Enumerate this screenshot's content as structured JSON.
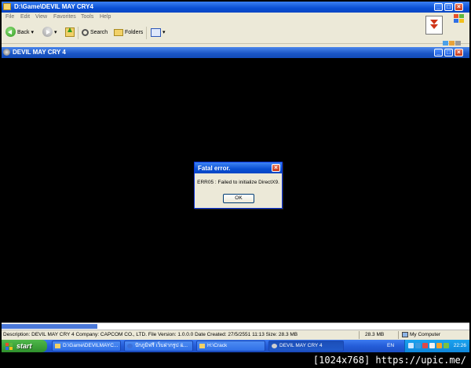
{
  "explorer": {
    "title": "D:\\Game\\DEVIL MAY CRY4",
    "menu": [
      "File",
      "Edit",
      "View",
      "Favorites",
      "Tools",
      "Help"
    ],
    "toolbar": {
      "back_label": "Back",
      "search_label": "Search",
      "folders_label": "Folders"
    },
    "status": {
      "description": "Description: DEVIL MAY CRY 4 Company: CAPCOM CO., LTD. File Version: 1.0.0.0 Date Created: 27/5/2551 11:13 Size: 28.3 MB",
      "size": "28.3 MB",
      "location": "My Computer"
    }
  },
  "game_window": {
    "title": "DEVIL MAY CRY 4"
  },
  "dialog": {
    "title": "Fatal error.",
    "message": "ERR05 : Failed to initialize DirectX9.",
    "ok_label": "OK"
  },
  "taskbar": {
    "start_label": "start",
    "tasks": [
      {
        "label": "D:\\Game\\DEVILMAYC..."
      },
      {
        "label": "ปักภูมิฟรี เว็บฝากรูป &..."
      },
      {
        "label": "H:\\Crack"
      },
      {
        "label": "DEVIL MAY CRY 4"
      }
    ],
    "language": "EN",
    "clock": "22:26"
  },
  "caption": "[1024x768] https://upic.me/",
  "colors": {
    "title_blue": "#0a4fd4",
    "start_green": "#2f8f2c",
    "tray_blue": "#0f86da",
    "close_red": "#c8391a"
  }
}
